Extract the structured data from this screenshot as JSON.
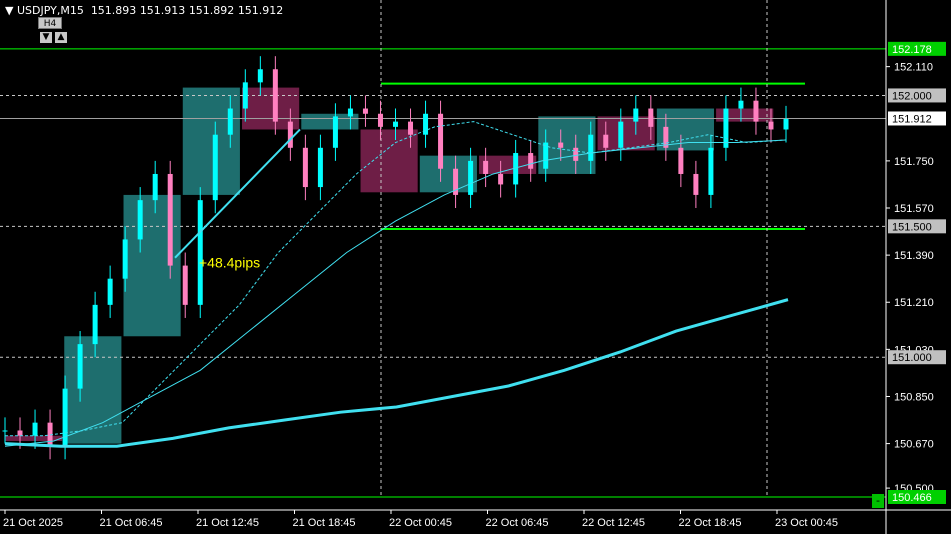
{
  "header": {
    "menu_icon": "triangle-down-icon",
    "symbol_tf": "USDJPY,M15",
    "bid": "151.893",
    "high": "151.913",
    "low": "151.892",
    "close": "151.912"
  },
  "controls": {
    "tf_button": "H4",
    "down_icon": "triangle-down-icon",
    "up_icon": "triangle-up-icon",
    "corner_button": "-"
  },
  "annotation": {
    "text": "+48.4pips",
    "color": "#ffff00"
  },
  "colors": {
    "background": "#000000",
    "bull_candle": "#00ffff",
    "bear_candle": "#ff80c0",
    "bull_box": "#1e6e6e",
    "bear_box": "#6e1e46",
    "ma_line": "#40e0f0",
    "level_line": "#00ff00",
    "grid": "#c8c8c8"
  },
  "chart_data": {
    "type": "candlestick",
    "symbol": "USDJPY",
    "timeframe": "M15",
    "ylim": [
      150.466,
      152.25
    ],
    "price_ticks": [
      "152.110",
      "151.750",
      "151.570",
      "151.390",
      "151.210",
      "151.030",
      "150.850",
      "150.670",
      "150.500"
    ],
    "time_ticks": [
      "21 Oct 2025",
      "21 Oct 06:45",
      "21 Oct 12:45",
      "21 Oct 18:45",
      "22 Oct 00:45",
      "22 Oct 06:45",
      "22 Oct 12:45",
      "22 Oct 18:45",
      "23 Oct 00:45"
    ],
    "price_labels": [
      {
        "text": "152.178",
        "value": 152.178,
        "style": "green"
      },
      {
        "text": "152.000",
        "value": 152.0,
        "style": "gray"
      },
      {
        "text": "151.912",
        "value": 151.912,
        "style": "white"
      },
      {
        "text": "151.500",
        "value": 151.5,
        "style": "gray"
      },
      {
        "text": "151.000",
        "value": 151.0,
        "style": "gray"
      },
      {
        "text": "150.466",
        "value": 150.466,
        "style": "green"
      }
    ],
    "horizontal_lines": [
      {
        "value": 152.178,
        "style": "green-full"
      },
      {
        "value": 152.0,
        "style": "dotted"
      },
      {
        "value": 151.912,
        "style": "solid-gray"
      },
      {
        "value": 151.5,
        "style": "dotted"
      },
      {
        "value": 151.0,
        "style": "dotted"
      },
      {
        "value": 150.466,
        "style": "green-full"
      },
      {
        "value": 152.045,
        "style": "green-segment",
        "from": "22 Oct 00:45",
        "to": "23 Oct 00:45"
      },
      {
        "value": 151.49,
        "style": "green-segment",
        "from": "22 Oct 00:45",
        "to": "23 Oct 00:45"
      }
    ],
    "vertical_dotted_lines": [
      "22 Oct 00:45",
      "23 Oct 00:45"
    ],
    "h4_boxes": [
      {
        "open": 150.68,
        "close": 150.7,
        "dir": "bear"
      },
      {
        "open": 150.67,
        "close": 151.08,
        "dir": "bull"
      },
      {
        "open": 151.08,
        "close": 151.62,
        "dir": "bull"
      },
      {
        "open": 151.62,
        "close": 152.03,
        "dir": "bull"
      },
      {
        "open": 152.03,
        "close": 151.87,
        "dir": "bear"
      },
      {
        "open": 151.87,
        "close": 151.93,
        "dir": "bull"
      },
      {
        "open": 151.87,
        "close": 151.63,
        "dir": "bear"
      },
      {
        "open": 151.63,
        "close": 151.77,
        "dir": "bull"
      },
      {
        "open": 151.77,
        "close": 151.7,
        "dir": "bear"
      },
      {
        "open": 151.7,
        "close": 151.92,
        "dir": "bull"
      },
      {
        "open": 151.92,
        "close": 151.79,
        "dir": "bear"
      },
      {
        "open": 151.79,
        "close": 151.95,
        "dir": "bull"
      },
      {
        "open": 151.95,
        "close": 151.9,
        "dir": "bear"
      }
    ],
    "candles_close_path": [
      150.72,
      150.7,
      150.75,
      150.66,
      150.88,
      151.05,
      151.2,
      151.3,
      151.45,
      151.6,
      151.7,
      151.35,
      151.2,
      151.6,
      151.85,
      151.95,
      152.05,
      152.1,
      151.9,
      151.8,
      151.65,
      151.8,
      151.92,
      151.95,
      151.93,
      151.88,
      151.9,
      151.85,
      151.93,
      151.72,
      151.62,
      151.75,
      151.7,
      151.66,
      151.78,
      151.72,
      151.82,
      151.8,
      151.75,
      151.85,
      151.8,
      151.9,
      151.95,
      151.88,
      151.8,
      151.7,
      151.62,
      151.8,
      151.95,
      151.98,
      151.9,
      151.87,
      151.91
    ],
    "ma_fast": [
      150.7,
      150.7,
      150.72,
      150.75,
      150.9,
      151.05,
      151.2,
      151.4,
      151.55,
      151.7,
      151.82,
      151.88,
      151.9,
      151.85,
      151.8,
      151.78,
      151.8,
      151.82,
      151.85,
      151.82,
      151.83
    ],
    "ma_mid": [
      150.66,
      150.68,
      150.75,
      150.85,
      150.95,
      151.1,
      151.25,
      151.4,
      151.52,
      151.62,
      151.7,
      151.75,
      151.78,
      151.8,
      151.82,
      151.82,
      151.83
    ],
    "ma_slow": [
      150.67,
      150.66,
      150.66,
      150.69,
      150.73,
      150.76,
      150.79,
      150.81,
      150.85,
      150.89,
      150.95,
      151.02,
      151.1,
      151.16,
      151.22
    ],
    "move_line": {
      "from": 151.38,
      "to": 151.87
    }
  }
}
